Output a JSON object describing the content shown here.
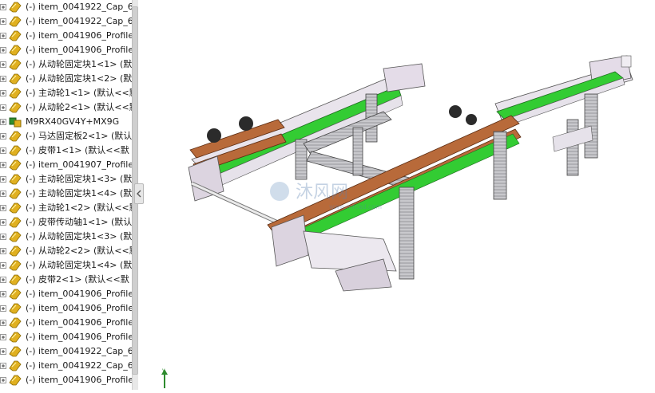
{
  "feature_tree": {
    "items": [
      {
        "label": "(-) item_0041922_Cap_6",
        "icon": "part-icon"
      },
      {
        "label": "(-) item_0041922_Cap_6",
        "icon": "part-icon"
      },
      {
        "label": "(-) item_0041906_Profile",
        "icon": "part-icon"
      },
      {
        "label": "(-) item_0041906_Profile",
        "icon": "part-icon"
      },
      {
        "label": "(-) 从动轮固定块1<1> (默",
        "icon": "part-icon"
      },
      {
        "label": "(-) 从动轮固定块1<2> (默",
        "icon": "part-icon"
      },
      {
        "label": "(-) 主动轮1<1> (默认<<默",
        "icon": "part-icon"
      },
      {
        "label": "(-) 从动轮2<1> (默认<<默",
        "icon": "part-icon"
      },
      {
        "label": "M9RX40GV4Y+MX9G",
        "icon": "subassembly-icon"
      },
      {
        "label": "(-) 马达固定板2<1> (默认",
        "icon": "part-icon"
      },
      {
        "label": "(-) 皮带1<1> (默认<<默",
        "icon": "part-icon"
      },
      {
        "label": "(-) item_0041907_Profile",
        "icon": "part-icon"
      },
      {
        "label": "(-) 主动轮固定块1<3> (默",
        "icon": "part-icon"
      },
      {
        "label": "(-) 主动轮固定块1<4> (默",
        "icon": "part-icon"
      },
      {
        "label": "(-) 主动轮1<2> (默认<<默",
        "icon": "part-icon"
      },
      {
        "label": "(-) 皮带传动轴1<1> (默认",
        "icon": "part-icon"
      },
      {
        "label": "(-) 从动轮固定块1<3> (默",
        "icon": "part-icon"
      },
      {
        "label": "(-) 从动轮2<2> (默认<<默",
        "icon": "part-icon"
      },
      {
        "label": "(-) 从动轮固定块1<4> (默",
        "icon": "part-icon"
      },
      {
        "label": "(-) 皮带2<1> (默认<<默",
        "icon": "part-icon"
      },
      {
        "label": "(-) item_0041906_Profile",
        "icon": "part-icon"
      },
      {
        "label": "(-) item_0041906_Profile",
        "icon": "part-icon"
      },
      {
        "label": "(-) item_0041906_Profile",
        "icon": "part-icon"
      },
      {
        "label": "(-) item_0041906_Profile",
        "icon": "part-icon"
      },
      {
        "label": "(-) item_0041922_Cap_6",
        "icon": "part-icon"
      },
      {
        "label": "(-) item_0041922_Cap_6",
        "icon": "part-icon"
      },
      {
        "label": "(-) item_0041906_Profile",
        "icon": "part-icon"
      }
    ]
  },
  "watermark": {
    "text": "沐风网",
    "url": "www.mfcad.com"
  },
  "colors": {
    "belt": "#33cc33",
    "frame": "#d8d0dc",
    "guide_rail": "#b86a3a",
    "part_icon": "#e0b020",
    "assembly_icon": "#2f8f2f"
  }
}
